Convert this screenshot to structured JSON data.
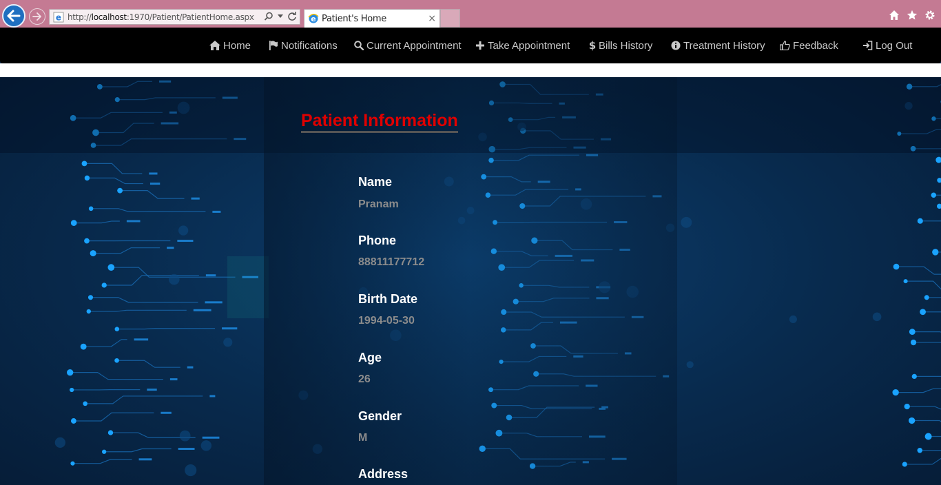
{
  "browser": {
    "url_prefix": "http://",
    "url_host": "localhost",
    "url_rest": ":1970/Patient/PatientHome.aspx",
    "tab_title": "Patient's Home",
    "tab_close": "×"
  },
  "navbar": {
    "items": [
      {
        "label": "Home",
        "icon": "home-icon"
      },
      {
        "label": "Notifications",
        "icon": "flag-icon"
      },
      {
        "label": "Current Appointment",
        "icon": "search-icon"
      },
      {
        "label": "Take Appointment",
        "icon": "plus-icon"
      },
      {
        "label": "Bills History",
        "icon": "dollar-icon"
      },
      {
        "label": "Treatment History",
        "icon": "info-icon"
      },
      {
        "label": "Feedback",
        "icon": "thumbs-up-icon"
      },
      {
        "label": "Log Out",
        "icon": "log-out-icon"
      }
    ]
  },
  "main": {
    "title": "Patient Information",
    "fields": [
      {
        "label": "Name",
        "value": "Pranam"
      },
      {
        "label": "Phone",
        "value": "88811177712"
      },
      {
        "label": "Birth Date",
        "value": "1994-05-30"
      },
      {
        "label": "Age",
        "value": "26"
      },
      {
        "label": "Gender",
        "value": "M"
      },
      {
        "label": "Address",
        "value": ""
      }
    ]
  },
  "colors": {
    "heading": "#e00000",
    "navbar_bg": "#000000",
    "chrome_bg": "#c47a93",
    "background": "#0a2a4a"
  }
}
